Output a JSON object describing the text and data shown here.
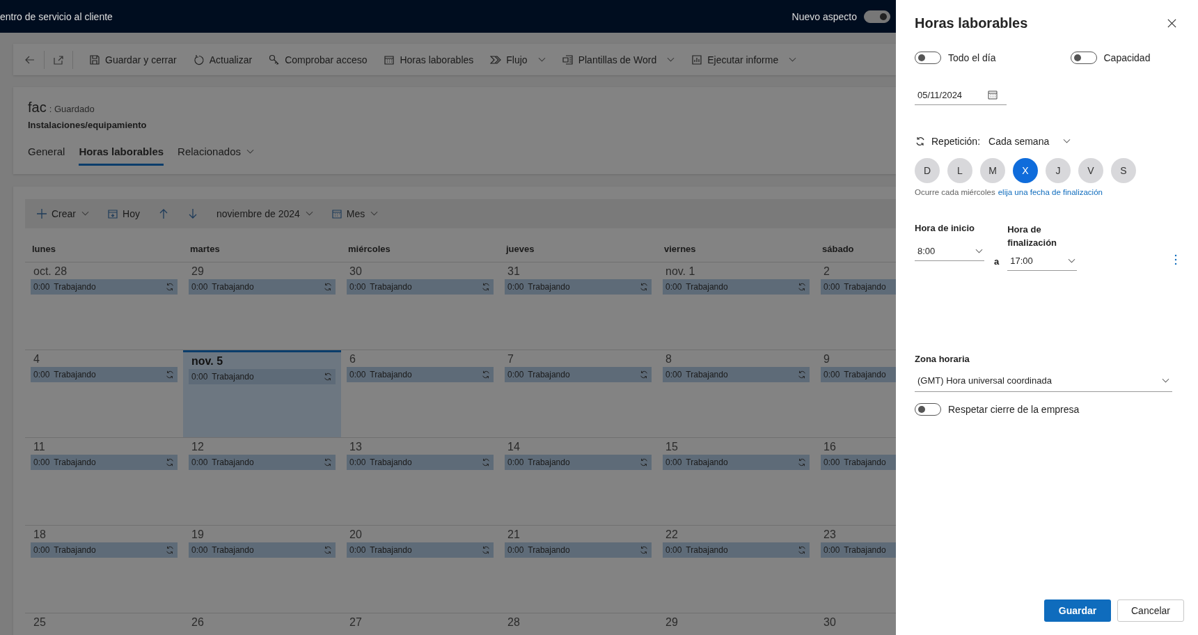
{
  "top_bar": {
    "title": "entro de servicio al cliente",
    "new_look": {
      "label": "Nuevo aspecto",
      "on": true
    }
  },
  "toolbar": [
    {
      "kind": "save",
      "label": "Guardar y cerrar"
    },
    {
      "kind": "refresh",
      "label": "Actualizar"
    },
    {
      "kind": "access",
      "label": "Comprobar acceso"
    },
    {
      "kind": "calendar",
      "label": "Horas laborables"
    },
    {
      "kind": "flow",
      "label": "Flujo",
      "dropdown": true
    },
    {
      "kind": "word",
      "label": "Plantillas de Word",
      "dropdown": true
    },
    {
      "kind": "report",
      "label": "Ejecutar informe",
      "dropdown": true
    }
  ],
  "record": {
    "name": "fac",
    "status": ": Guardado",
    "entity": "Instalaciones/equipamiento",
    "tabs": [
      {
        "label": "General",
        "selected": false
      },
      {
        "label": "Horas laborables",
        "selected": true
      },
      {
        "label": "Relacionados",
        "selected": false,
        "dropdown": true
      }
    ]
  },
  "calendar": {
    "toolbar": [
      {
        "kind": "create",
        "label": "Crear",
        "dropdown": true
      },
      {
        "kind": "today",
        "label": "Hoy"
      },
      {
        "kind": "up"
      },
      {
        "kind": "down"
      },
      {
        "kind": "month",
        "label": "noviembre de 2024",
        "dropdown": true
      },
      {
        "kind": "view",
        "label": "Mes",
        "dropdown": true
      }
    ],
    "weekdays": [
      "lunes",
      "martes",
      "miércoles",
      "jueves",
      "viernes",
      "sábado"
    ],
    "weeks": [
      [
        {
          "date": "oct. 28",
          "today": false,
          "event": {
            "time": "0:00",
            "label": "Trabajando"
          }
        },
        {
          "date": "29",
          "today": false,
          "event": {
            "time": "0:00",
            "label": "Trabajando"
          }
        },
        {
          "date": "30",
          "today": false,
          "event": {
            "time": "0:00",
            "label": "Trabajando"
          }
        },
        {
          "date": "31",
          "today": false,
          "event": {
            "time": "0:00",
            "label": "Trabajando"
          }
        },
        {
          "date": "nov. 1",
          "today": false,
          "event": {
            "time": "0:00",
            "label": "Trabajando"
          }
        },
        {
          "date": "2",
          "today": false,
          "event": {
            "time": "0:00",
            "label": "Trabajando"
          }
        }
      ],
      [
        {
          "date": "4",
          "today": false,
          "event": {
            "time": "0:00",
            "label": "Trabajando"
          }
        },
        {
          "date": "nov. 5",
          "today": true,
          "event": {
            "time": "0:00",
            "label": "Trabajando"
          }
        },
        {
          "date": "6",
          "today": false,
          "event": {
            "time": "0:00",
            "label": "Trabajando"
          }
        },
        {
          "date": "7",
          "today": false,
          "event": {
            "time": "0:00",
            "label": "Trabajando"
          }
        },
        {
          "date": "8",
          "today": false,
          "event": {
            "time": "0:00",
            "label": "Trabajando"
          }
        },
        {
          "date": "9",
          "today": false,
          "event": {
            "time": "0:00",
            "label": "Trabajando"
          }
        }
      ],
      [
        {
          "date": "11",
          "today": false,
          "event": {
            "time": "0:00",
            "label": "Trabajando"
          }
        },
        {
          "date": "12",
          "today": false,
          "event": {
            "time": "0:00",
            "label": "Trabajando"
          }
        },
        {
          "date": "13",
          "today": false,
          "event": {
            "time": "0:00",
            "label": "Trabajando"
          }
        },
        {
          "date": "14",
          "today": false,
          "event": {
            "time": "0:00",
            "label": "Trabajando"
          }
        },
        {
          "date": "15",
          "today": false,
          "event": {
            "time": "0:00",
            "label": "Trabajando"
          }
        },
        {
          "date": "16",
          "today": false,
          "event": {
            "time": "0:00",
            "label": "Trabajando"
          }
        }
      ],
      [
        {
          "date": "18",
          "today": false,
          "event": {
            "time": "0:00",
            "label": "Trabajando"
          }
        },
        {
          "date": "19",
          "today": false,
          "event": {
            "time": "0:00",
            "label": "Trabajando"
          }
        },
        {
          "date": "20",
          "today": false,
          "event": {
            "time": "0:00",
            "label": "Trabajando"
          }
        },
        {
          "date": "21",
          "today": false,
          "event": {
            "time": "0:00",
            "label": "Trabajando"
          }
        },
        {
          "date": "22",
          "today": false,
          "event": {
            "time": "0:00",
            "label": "Trabajando"
          }
        },
        {
          "date": "23",
          "today": false,
          "event": {
            "time": "0:00",
            "label": "Trabajando"
          }
        }
      ],
      [
        {
          "date": "25",
          "today": false
        },
        {
          "date": "26",
          "today": false
        },
        {
          "date": "27",
          "today": false
        },
        {
          "date": "28",
          "today": false
        },
        {
          "date": "29",
          "today": false
        },
        {
          "date": "30",
          "today": false
        }
      ]
    ]
  },
  "panel": {
    "title": "Horas laborables",
    "toggles": [
      {
        "label": "Todo el día",
        "on": false
      },
      {
        "label": "Capacidad",
        "on": false
      }
    ],
    "date": "05/11/2024",
    "repetition": {
      "label": "Repetición:",
      "value": "Cada semana"
    },
    "days": [
      {
        "label": "D",
        "selected": false
      },
      {
        "label": "L",
        "selected": false
      },
      {
        "label": "M",
        "selected": false
      },
      {
        "label": "X",
        "selected": true
      },
      {
        "label": "J",
        "selected": false
      },
      {
        "label": "V",
        "selected": false
      },
      {
        "label": "S",
        "selected": false
      }
    ],
    "summary": "Ocurre cada miércoles",
    "end_link": "elija una fecha de finalización",
    "start": {
      "label": "Hora de inicio",
      "value": "8:00"
    },
    "separator": "a",
    "end": {
      "label": "Hora de finalización",
      "value": "17:00"
    },
    "timezone": {
      "label": "Zona horaria",
      "value": "(GMT) Hora universal coordinada"
    },
    "closure": {
      "label": "Respetar cierre de la empresa",
      "on": false
    },
    "buttons": [
      {
        "kind": "primary",
        "label": "Guardar"
      },
      {
        "kind": "secondary",
        "label": "Cancelar"
      }
    ]
  }
}
